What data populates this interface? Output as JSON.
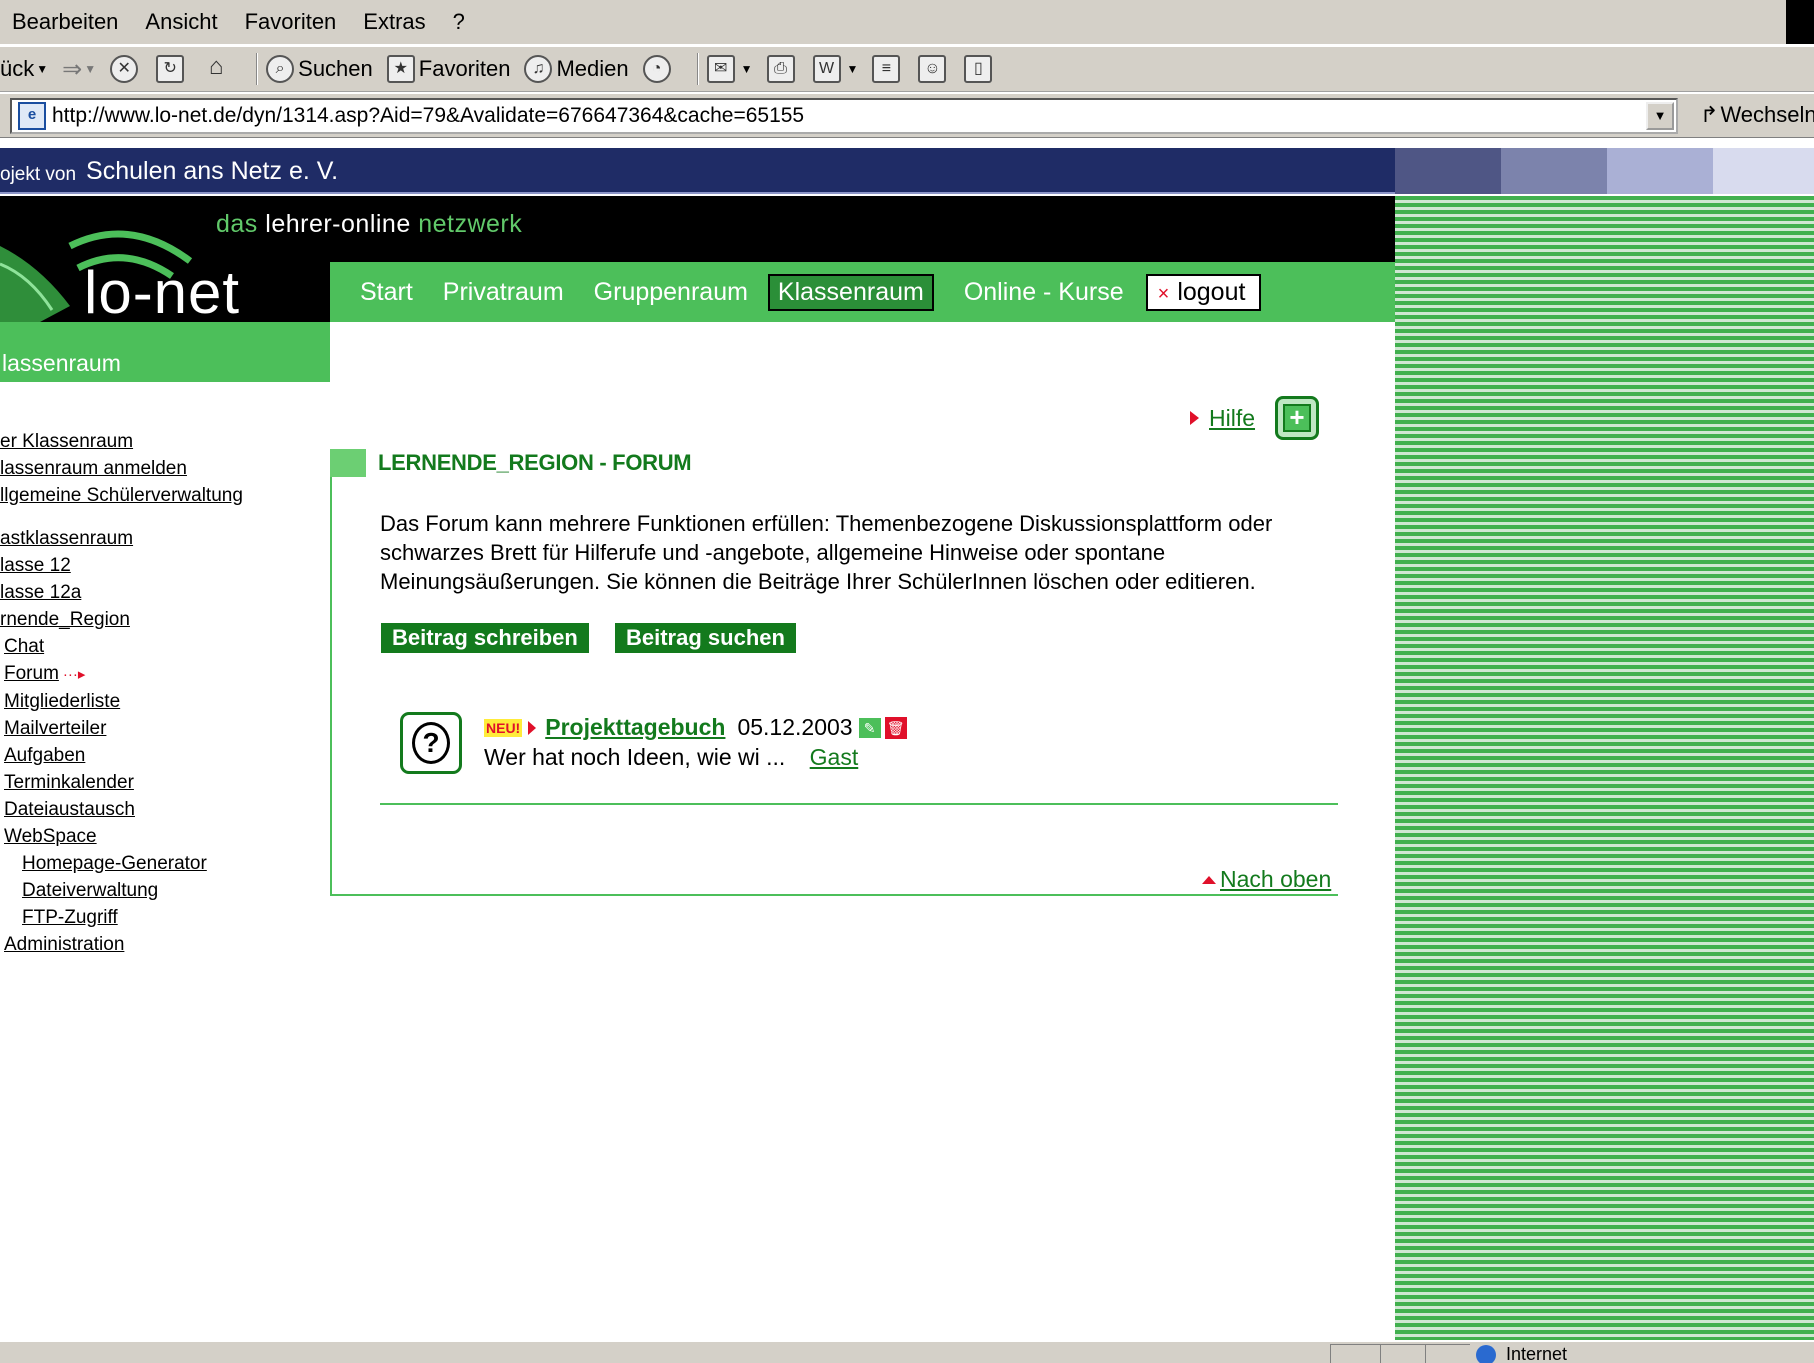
{
  "browser": {
    "menu": [
      "Bearbeiten",
      "Ansicht",
      "Favoriten",
      "Extras",
      "?"
    ],
    "toolbar": {
      "back": "ück",
      "search": "Suchen",
      "favorites": "Favoriten",
      "media": "Medien"
    },
    "address": "http://www.lo-net.de/dyn/1314.asp?Aid=79&Avalidate=676647364&cache=65155",
    "go_label": "Wechseln",
    "status_zone": "Internet"
  },
  "header": {
    "project_prefix": "ojekt von",
    "project_name": "Schulen ans Netz e. V.",
    "tagline_1": "das",
    "tagline_2": "lehrer-online",
    "tagline_3": "netzwerk",
    "logo": "lo-net",
    "swatch_colors": [
      "#4f5685",
      "#7c83ac",
      "#aab0d5",
      "#d8dbee"
    ],
    "section": "lassenraum"
  },
  "nav": {
    "items": [
      "Start",
      "Privatraum",
      "Gruppenraum",
      "Klassenraum",
      "Online - Kurse"
    ],
    "active": "Klassenraum",
    "logout": "logout"
  },
  "sidebar": {
    "group1": [
      "er Klassenraum",
      "lassenraum anmelden",
      "llgemeine Schülerverwaltung"
    ],
    "group2": [
      "astklassenraum",
      "lasse 12",
      "lasse 12a",
      "rnende_Region"
    ],
    "sub": [
      "Chat",
      "Forum",
      "Mitgliederliste",
      "Mailverteiler",
      "Aufgaben",
      "Terminkalender",
      "Dateiaustausch",
      "WebSpace"
    ],
    "webspace_sub": [
      "Homepage-Generator",
      "Dateiverwaltung",
      "FTP-Zugriff"
    ],
    "admin": "Administration"
  },
  "main": {
    "help": "Hilfe",
    "title": "LERNENDE_REGION - FORUM",
    "intro": "Das Forum kann mehrere Funktionen erfüllen: Themenbezogene Diskussionsplattform oder schwarzes Brett für Hilferufe und -angebote, allgemeine Hinweise oder spontane Meinungsäußerungen. Sie können die Beiträge Ihrer SchülerInnen löschen oder editieren.",
    "btn_write": "Beitrag schreiben",
    "btn_search": "Beitrag suchen",
    "post": {
      "badge": "NEU!",
      "title": "Projekttagebuch",
      "date": "05.12.2003",
      "excerpt": "Wer hat noch Ideen, wie wi ...",
      "author": "Gast"
    },
    "to_top": "Nach oben"
  },
  "colors": {
    "green": "#4cbf5a",
    "dark_green": "#137a1d",
    "navy": "#1f2c66",
    "red": "#e0102a"
  }
}
